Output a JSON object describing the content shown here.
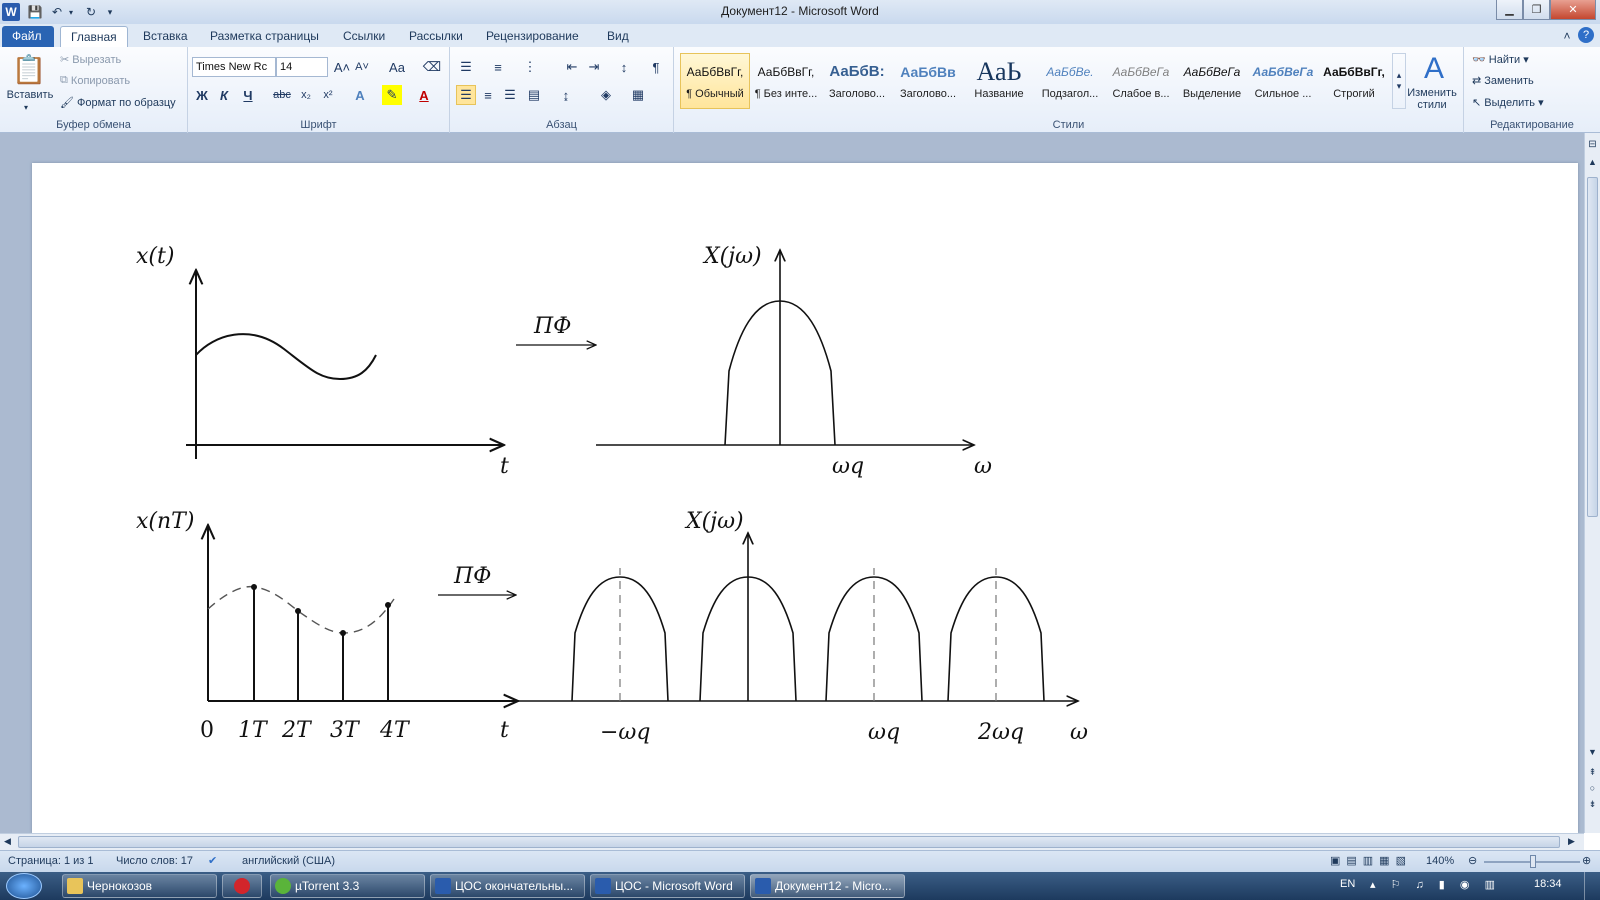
{
  "window": {
    "title": "Документ12 - Microsoft Word"
  },
  "tabs": [
    "Файл",
    "Главная",
    "Вставка",
    "Разметка страницы",
    "Ссылки",
    "Рассылки",
    "Рецензирование",
    "Вид"
  ],
  "clipboard": {
    "paste": "Вставить",
    "cut": "Вырезать",
    "copy": "Копировать",
    "format_painter": "Формат по образцу",
    "label": "Буфер обмена"
  },
  "font": {
    "name": "Times New Rc",
    "size": "14",
    "label": "Шрифт",
    "bold": "Ж",
    "italic": "К",
    "underline": "Ч",
    "strike": "abc",
    "sub": "x₂",
    "sup": "x²",
    "grow": "A˄",
    "shrink": "A˅",
    "case": "Aa",
    "color": "A"
  },
  "paragraph": {
    "label": "Абзац",
    "pilcrow": "¶"
  },
  "styles": {
    "label": "Стили",
    "items": [
      {
        "preview": "АаБбВвГг,",
        "name": "¶ Обычный"
      },
      {
        "preview": "АаБбВвГг,",
        "name": "¶ Без инте..."
      },
      {
        "preview": "АаБбВ:",
        "name": "Заголово..."
      },
      {
        "preview": "АаБбВв",
        "name": "Заголово..."
      },
      {
        "preview": "АаЬ",
        "name": "Название"
      },
      {
        "preview": "АаБбВе.",
        "name": "Подзагол..."
      },
      {
        "preview": "АаБбВеГа",
        "name": "Слабое в..."
      },
      {
        "preview": "АаБбВеГа",
        "name": "Выделение"
      },
      {
        "preview": "АаБбВеГа",
        "name": "Сильное ..."
      },
      {
        "preview": "АаБбВвГг,",
        "name": "Строгий"
      }
    ],
    "change_styles": "Изменить стили"
  },
  "editing": {
    "label": "Редактирование",
    "find": "Найти",
    "replace": "Заменить",
    "select": "Выделить"
  },
  "figure": {
    "top_left_ylabel": "x(t)",
    "top_left_xlabel": "t",
    "top_arrow_label": "ПФ",
    "top_right_ylabel": "X(jω)",
    "top_right_tick": "ωq",
    "top_right_xlabel": "ω",
    "bottom_left_ylabel": "x(nT)",
    "bottom_left_ticks": [
      "0",
      "1T",
      "2T",
      "3T",
      "4T"
    ],
    "bottom_left_xlabel": "t",
    "bottom_arrow_label": "ПФ",
    "bottom_right_ylabel": "X(jω)",
    "bottom_right_ticks": [
      "−ωq",
      "ωq",
      "2ωq"
    ],
    "bottom_right_xlabel": "ω"
  },
  "status": {
    "page": "Страница: 1 из 1",
    "words": "Число слов: 17",
    "language": "английский (США)",
    "zoom": "140%"
  },
  "taskbar": {
    "items": [
      "Чернокозов",
      "",
      "µTorrent 3.3",
      "ЦОС окончательны...",
      "ЦОС - Microsoft Word",
      "Документ12 - Micro..."
    ],
    "lang": "EN",
    "time": "18:34"
  },
  "colors": {
    "accent": "#2a64b3",
    "ribbon_bg": "#e6eef9",
    "doc_bg": "#abbad0"
  }
}
